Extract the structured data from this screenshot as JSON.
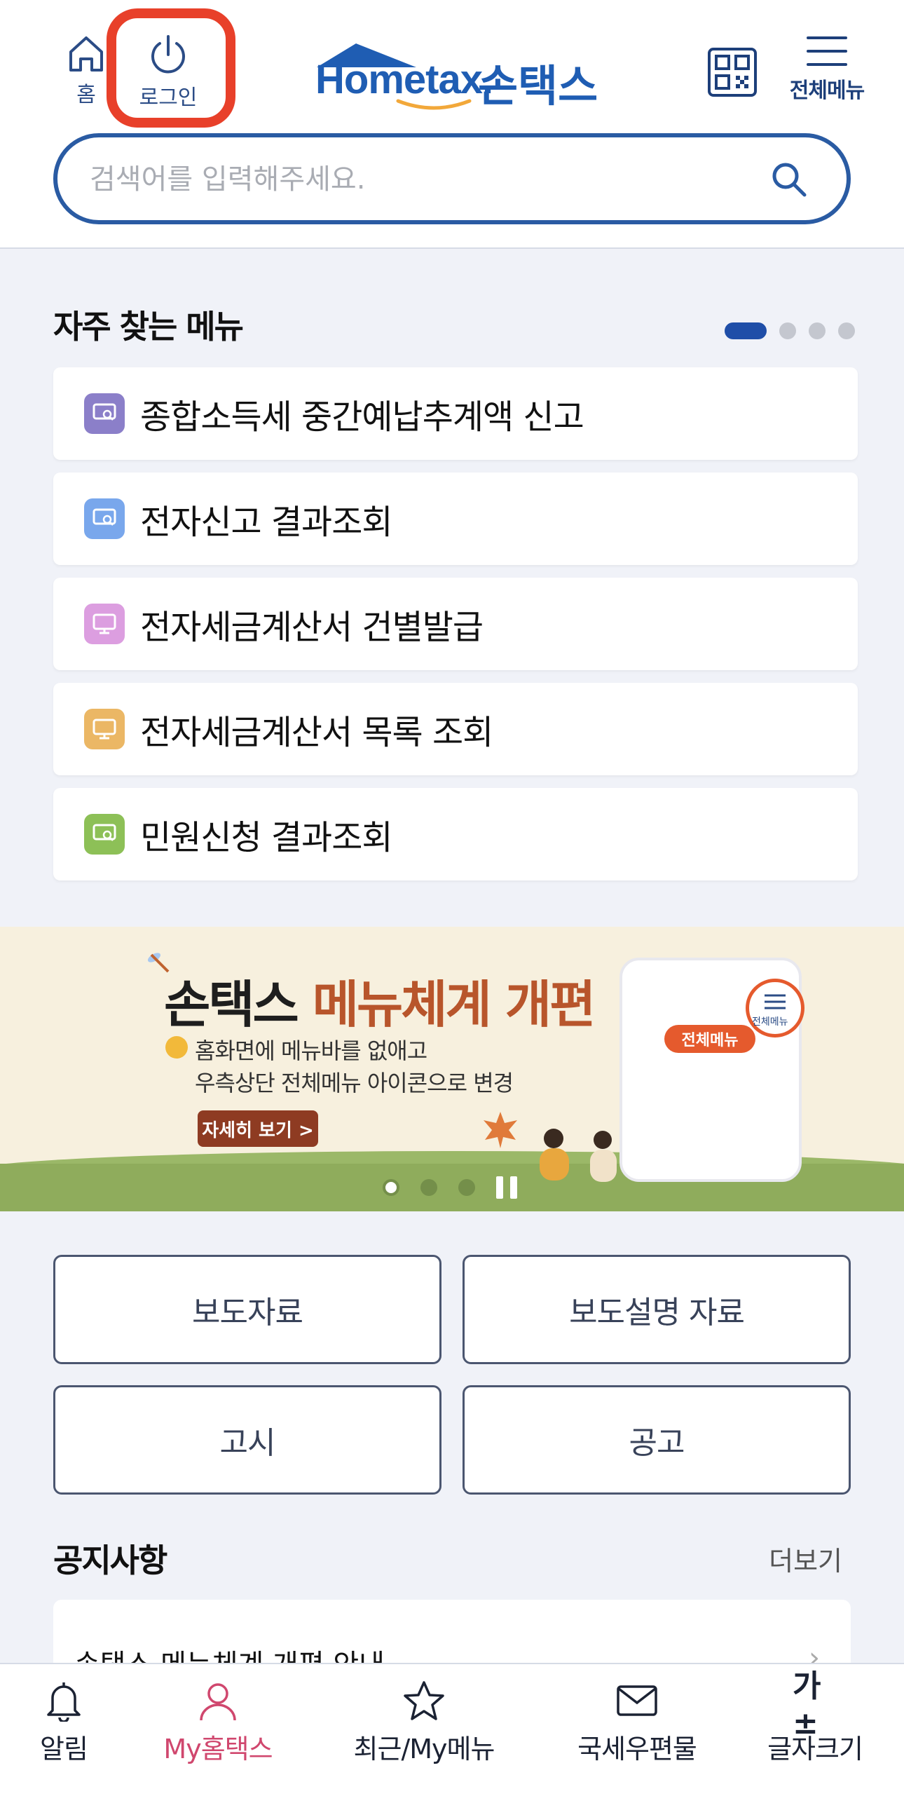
{
  "header": {
    "home_label": "홈",
    "login_label": "로그인",
    "logo_brand_home": "Home",
    "logo_brand_tax": "tax.",
    "logo_korean": "손택스",
    "menu_label": "전체메뉴"
  },
  "search": {
    "placeholder": "검색어를 입력해주세요."
  },
  "favorites": {
    "title": "자주 찾는 메뉴",
    "items": [
      {
        "label": "종합소득세 중간예납추계액 신고",
        "color": "#8b7fc9"
      },
      {
        "label": "전자신고 결과조회",
        "color": "#79a7ec"
      },
      {
        "label": "전자세금계산서 건별발급",
        "color": "#dc9ee0"
      },
      {
        "label": "전자세금계산서 목록 조회",
        "color": "#ebb765"
      },
      {
        "label": "민원신청 결과조회",
        "color": "#8dc057"
      }
    ]
  },
  "banner": {
    "title_part1": "손택스 ",
    "title_part2": "메뉴체계 개편",
    "line1": "홈화면에 메뉴바를 없애고",
    "line2": "우측상단 전체메뉴 아이콘으로 변경",
    "more_button": "자세히 보기 >",
    "phone_tag": "전체메뉴",
    "phone_bubble_label": "전체메뉴"
  },
  "quick_buttons": [
    "보도자료",
    "보도설명 자료",
    "고시",
    "공고"
  ],
  "notices": {
    "title": "공지사항",
    "more": "더보기",
    "items": [
      "손택스 메뉴체계 개편 안내"
    ]
  },
  "bottom_nav": {
    "items": [
      {
        "label": "알림",
        "icon": "bell-icon"
      },
      {
        "label": "My홈택스",
        "icon": "person-icon"
      },
      {
        "label": "최근/My메뉴",
        "icon": "star-icon"
      },
      {
        "label": "국세우편물",
        "icon": "mail-icon"
      },
      {
        "label": "글자크기",
        "icon": "font-size-icon"
      }
    ]
  },
  "colors": {
    "accent": "#1f5db3",
    "highlight": "#e8402a",
    "active_nav": "#d0476e"
  }
}
